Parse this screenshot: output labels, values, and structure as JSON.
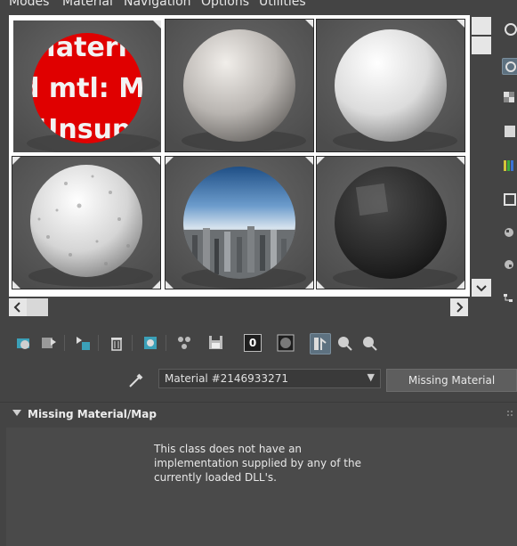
{
  "menu": {
    "items": [
      "Modes",
      "Material",
      "Navigation",
      "Options",
      "Utilities"
    ]
  },
  "slots": [
    {
      "label": "missing-material-slot",
      "type": "missing",
      "text_lines": [
        "Materi",
        "d mtl: Mis",
        "Unsup"
      ]
    },
    {
      "label": "grey-sphere-slot",
      "type": "sphere",
      "color": "#c9c5c2"
    },
    {
      "label": "white-sphere-slot",
      "type": "sphere",
      "color": "#ededed"
    },
    {
      "label": "stone-sphere-slot",
      "type": "sphere",
      "color": "#e4e4e4"
    },
    {
      "label": "city-sphere-slot",
      "type": "city"
    },
    {
      "label": "dark-sphere-slot",
      "type": "sphere",
      "color": "#2e2e2e"
    }
  ],
  "material": {
    "name": "Material #2146933271",
    "type_button": "Missing Material"
  },
  "rollout": {
    "title": "Missing Material/Map",
    "message_lines": [
      "This class does not have an",
      "implementation supplied by any of the",
      "currently loaded DLL's."
    ]
  },
  "toolbar": {
    "zero_label": "0"
  },
  "colors": {
    "background": "#444444",
    "missing_red": "#e00000",
    "active_button": "#5d7180"
  }
}
